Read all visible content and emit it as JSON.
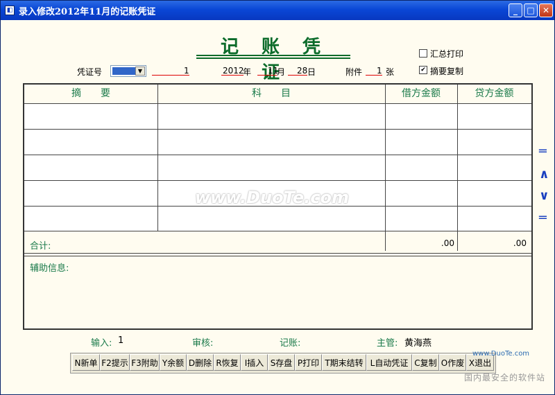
{
  "window": {
    "title": "录入修改2012年11月的记账凭证"
  },
  "heading": "记 账 凭 证",
  "voucher": {
    "no_label": "凭证号",
    "no_value": "1",
    "year": "2012",
    "year_label": "年",
    "month": "11",
    "month_label": "月",
    "day": "28",
    "day_label": "日",
    "attach_label": "附件",
    "attach_value": "1",
    "attach_unit": "张"
  },
  "options": {
    "summary_print": {
      "label": "汇总打印",
      "checked": false
    },
    "copy_abstract": {
      "label": "摘要复制",
      "checked": true,
      "mark": "✔"
    }
  },
  "table": {
    "headers": [
      "摘　　要",
      "科　　目",
      "借方金额",
      "贷方金额"
    ],
    "rows": 5,
    "total_label": "合计:",
    "debit_total": ".00",
    "credit_total": ".00"
  },
  "aux_label": "辅助信息:",
  "side_buttons": [
    "═",
    "∧",
    "∨",
    "═"
  ],
  "footer": {
    "input_label": "输入:",
    "input_value": "1",
    "review_label": "审核:",
    "post_label": "记账:",
    "supervisor_label": "主管:",
    "supervisor_value": "黄海燕"
  },
  "toolbar": [
    "N新单",
    "F2提示",
    "F3附助",
    "Y余额",
    "D删除",
    "R恢复",
    "I插入",
    "S存盘",
    "P打印",
    "T期末结转",
    "L自动凭证",
    "C复制",
    "O作废",
    "X退出"
  ],
  "watermarks": {
    "center": "www.DuoTe.com",
    "corner": "www.DuoTe.com",
    "footer": "国内最安全的软件站"
  }
}
